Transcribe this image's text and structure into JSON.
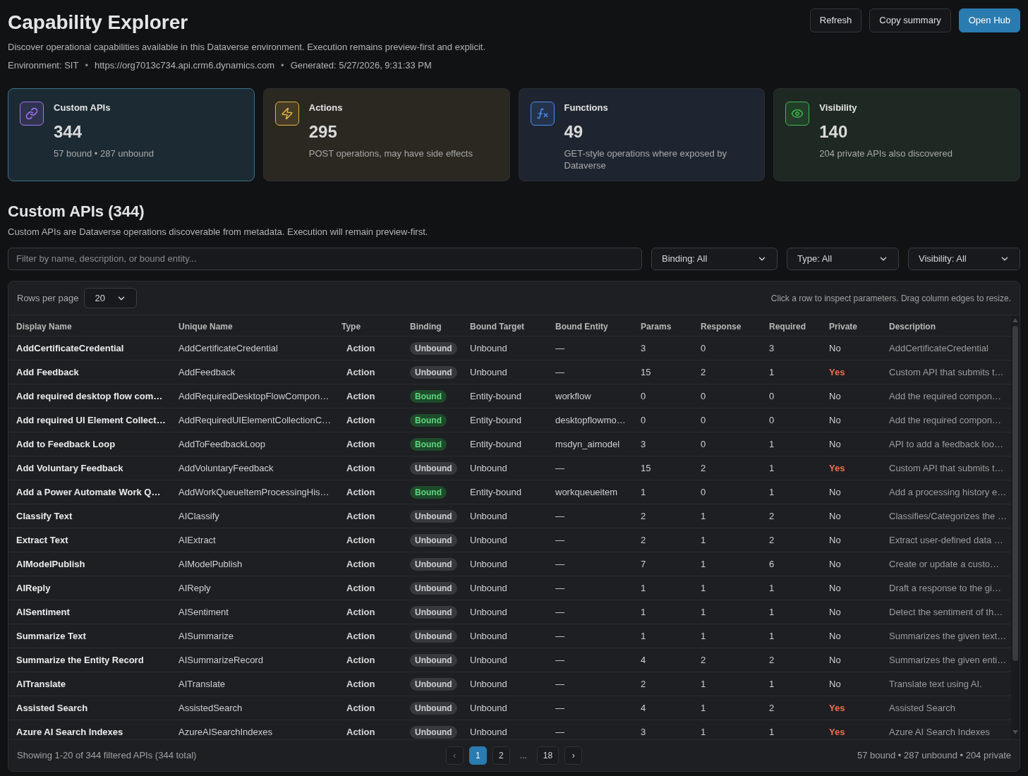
{
  "header": {
    "title": "Capability Explorer",
    "description": "Discover operational capabilities available in this Dataverse environment. Execution remains preview-first and explicit.",
    "meta": [
      {
        "kind": "text",
        "text": "Environment: SIT"
      },
      {
        "kind": "separator",
        "text": "•"
      },
      {
        "kind": "text",
        "text": "https://org7013c734.api.crm6.dynamics.com"
      },
      {
        "kind": "separator",
        "text": "•"
      },
      {
        "kind": "text",
        "text": "Generated: 5/27/2026, 9:31:33 PM"
      }
    ],
    "buttons": [
      {
        "label": "Refresh",
        "kind": "secondary"
      },
      {
        "label": "Copy summary",
        "kind": "secondary"
      },
      {
        "label": "Open Hub",
        "kind": "primary"
      }
    ]
  },
  "cards": [
    {
      "title": "Custom APIs",
      "value": "344",
      "caption": "57 bound • 287 unbound",
      "color": "#a371f7",
      "selected": true
    },
    {
      "title": "Actions",
      "value": "295",
      "caption": "POST operations, may have side effects",
      "color": "#e3b341",
      "selected": false
    },
    {
      "title": "Functions",
      "value": "49",
      "caption": "GET-style operations where exposed by Dataverse",
      "color": "#4a8cf0",
      "selected": false
    },
    {
      "title": "Visibility",
      "value": "140",
      "caption": "204 private APIs also discovered",
      "color": "#3fb950",
      "selected": false
    }
  ],
  "section": {
    "title": "Custom APIs (344)",
    "description": "Custom APIs are Dataverse operations discoverable from metadata. Execution will remain preview-first."
  },
  "filters": {
    "search": {
      "placeholder": "Filter by name, description, or bound entity..."
    },
    "selects": [
      {
        "value": "Binding: All"
      },
      {
        "value": "Type: All"
      },
      {
        "value": "Visibility: All"
      }
    ]
  },
  "table": {
    "rows_per_page": {
      "label": "Rows per page",
      "value": "20"
    },
    "hint": "Click a row to inspect parameters. Drag column edges to resize.",
    "columns": [
      "Display Name",
      "Unique Name",
      "Type",
      "Binding",
      "Bound Target",
      "Bound Entity",
      "Params",
      "Response",
      "Required",
      "Private",
      "Description"
    ],
    "rows": [
      {
        "display_name": "AddCertificateCredential",
        "unique_name": "AddCertificateCredential",
        "type": "Action",
        "binding": "Unbound",
        "bound": false,
        "bound_target": "Unbound",
        "bound_entity": "—",
        "params": "3",
        "response": "0",
        "required": "3",
        "private": "No",
        "is_private": false,
        "description": "AddCertificateCredential"
      },
      {
        "display_name": "Add Feedback",
        "unique_name": "AddFeedback",
        "type": "Action",
        "binding": "Unbound",
        "bound": false,
        "bound_target": "Unbound",
        "bound_entity": "—",
        "params": "15",
        "response": "2",
        "required": "1",
        "private": "Yes",
        "is_private": true,
        "description": "Custom API that submits t…"
      },
      {
        "display_name": "Add required desktop flow com…",
        "unique_name": "AddRequiredDesktopFlowCompon…",
        "type": "Action",
        "binding": "Bound",
        "bound": true,
        "bound_target": "Entity-bound",
        "bound_entity": "workflow",
        "params": "0",
        "response": "0",
        "required": "0",
        "private": "No",
        "is_private": false,
        "description": "Add the required compon…"
      },
      {
        "display_name": "Add required UI Element Collect…",
        "unique_name": "AddRequiredUIElementCollectionC…",
        "type": "Action",
        "binding": "Bound",
        "bound": true,
        "bound_target": "Entity-bound",
        "bound_entity": "desktopflowmo…",
        "params": "0",
        "response": "0",
        "required": "0",
        "private": "No",
        "is_private": false,
        "description": "Add the required compon…"
      },
      {
        "display_name": "Add to Feedback Loop",
        "unique_name": "AddToFeedbackLoop",
        "type": "Action",
        "binding": "Bound",
        "bound": true,
        "bound_target": "Entity-bound",
        "bound_entity": "msdyn_aimodel",
        "params": "3",
        "response": "0",
        "required": "1",
        "private": "No",
        "is_private": false,
        "description": "API to add a feedback loo…"
      },
      {
        "display_name": "Add Voluntary Feedback",
        "unique_name": "AddVoluntaryFeedback",
        "type": "Action",
        "binding": "Unbound",
        "bound": false,
        "bound_target": "Unbound",
        "bound_entity": "—",
        "params": "15",
        "response": "2",
        "required": "1",
        "private": "Yes",
        "is_private": true,
        "description": "Custom API that submits t…"
      },
      {
        "display_name": "Add a Power Automate Work Q…",
        "unique_name": "AddWorkQueueItemProcessingHis…",
        "type": "Action",
        "binding": "Bound",
        "bound": true,
        "bound_target": "Entity-bound",
        "bound_entity": "workqueueitem",
        "params": "1",
        "response": "0",
        "required": "1",
        "private": "No",
        "is_private": false,
        "description": "Add a processing history e…"
      },
      {
        "display_name": "Classify Text",
        "unique_name": "AIClassify",
        "type": "Action",
        "binding": "Unbound",
        "bound": false,
        "bound_target": "Unbound",
        "bound_entity": "—",
        "params": "2",
        "response": "1",
        "required": "2",
        "private": "No",
        "is_private": false,
        "description": "Classifies/Categorizes the …"
      },
      {
        "display_name": "Extract Text",
        "unique_name": "AIExtract",
        "type": "Action",
        "binding": "Unbound",
        "bound": false,
        "bound_target": "Unbound",
        "bound_entity": "—",
        "params": "2",
        "response": "1",
        "required": "2",
        "private": "No",
        "is_private": false,
        "description": "Extract user-defined data …"
      },
      {
        "display_name": "AIModelPublish",
        "unique_name": "AIModelPublish",
        "type": "Action",
        "binding": "Unbound",
        "bound": false,
        "bound_target": "Unbound",
        "bound_entity": "—",
        "params": "7",
        "response": "1",
        "required": "6",
        "private": "No",
        "is_private": false,
        "description": "Create or update a custo…"
      },
      {
        "display_name": "AIReply",
        "unique_name": "AIReply",
        "type": "Action",
        "binding": "Unbound",
        "bound": false,
        "bound_target": "Unbound",
        "bound_entity": "—",
        "params": "1",
        "response": "1",
        "required": "1",
        "private": "No",
        "is_private": false,
        "description": "Draft a response to the gi…"
      },
      {
        "display_name": "AISentiment",
        "unique_name": "AISentiment",
        "type": "Action",
        "binding": "Unbound",
        "bound": false,
        "bound_target": "Unbound",
        "bound_entity": "—",
        "params": "1",
        "response": "1",
        "required": "1",
        "private": "No",
        "is_private": false,
        "description": "Detect the sentiment of th…"
      },
      {
        "display_name": "Summarize Text",
        "unique_name": "AISummarize",
        "type": "Action",
        "binding": "Unbound",
        "bound": false,
        "bound_target": "Unbound",
        "bound_entity": "—",
        "params": "1",
        "response": "1",
        "required": "1",
        "private": "No",
        "is_private": false,
        "description": "Summarizes the given text…"
      },
      {
        "display_name": "Summarize the Entity Record",
        "unique_name": "AISummarizeRecord",
        "type": "Action",
        "binding": "Unbound",
        "bound": false,
        "bound_target": "Unbound",
        "bound_entity": "—",
        "params": "4",
        "response": "2",
        "required": "2",
        "private": "No",
        "is_private": false,
        "description": "Summarizes the given enti…"
      },
      {
        "display_name": "AITranslate",
        "unique_name": "AITranslate",
        "type": "Action",
        "binding": "Unbound",
        "bound": false,
        "bound_target": "Unbound",
        "bound_entity": "—",
        "params": "2",
        "response": "1",
        "required": "1",
        "private": "No",
        "is_private": false,
        "description": "Translate text using AI."
      },
      {
        "display_name": "Assisted Search",
        "unique_name": "AssistedSearch",
        "type": "Action",
        "binding": "Unbound",
        "bound": false,
        "bound_target": "Unbound",
        "bound_entity": "—",
        "params": "4",
        "response": "1",
        "required": "2",
        "private": "Yes",
        "is_private": true,
        "description": "Assisted Search"
      },
      {
        "display_name": "Azure AI Search Indexes",
        "unique_name": "AzureAISearchIndexes",
        "type": "Action",
        "binding": "Unbound",
        "bound": false,
        "bound_target": "Unbound",
        "bound_entity": "—",
        "params": "3",
        "response": "1",
        "required": "1",
        "private": "Yes",
        "is_private": true,
        "description": "Azure AI Search Indexes"
      }
    ]
  },
  "footer": {
    "showing": "Showing 1-20 of 344 filtered APIs (344 total)",
    "pagination": {
      "previous": {
        "label": "‹",
        "disabled": true
      },
      "pages": [
        {
          "kind": "page",
          "label": "1",
          "selected": true
        },
        {
          "kind": "page",
          "label": "2",
          "selected": false
        },
        {
          "kind": "gap",
          "label": "...",
          "selected": false
        },
        {
          "kind": "page",
          "label": "18",
          "selected": false
        }
      ],
      "next": {
        "label": "›",
        "disabled": false
      }
    },
    "summary": "57 bound • 287 unbound • 204 private"
  }
}
